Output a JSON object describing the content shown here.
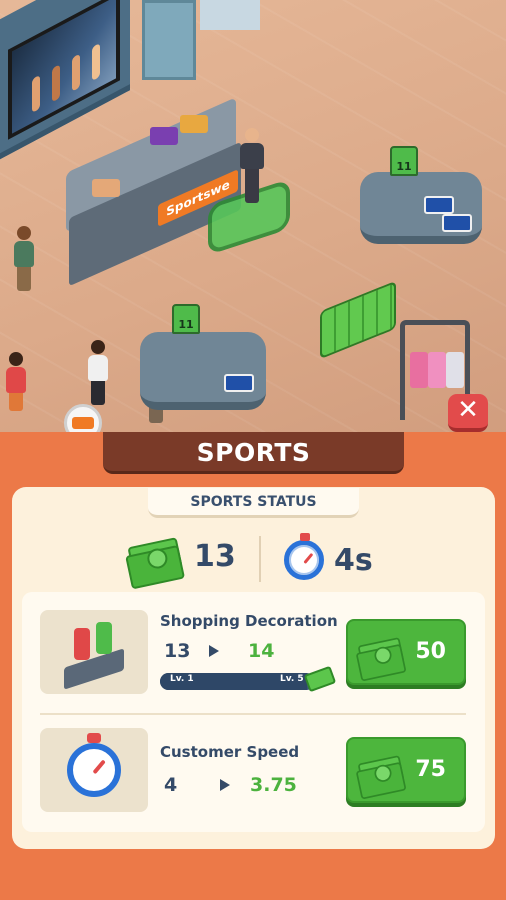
{
  "scene": {
    "counter_sign": "Sportswe",
    "jersey_number": "11",
    "close_label": "✕"
  },
  "panel": {
    "title": "SPORTS",
    "status_label": "SPORTS STATUS",
    "stats": {
      "cash_value": "13",
      "time_value": "4s",
      "cash_icon": "cash-icon",
      "time_icon": "stopwatch-icon"
    }
  },
  "upgrades": [
    {
      "name": "Shopping Decoration",
      "from": "13",
      "to": "14",
      "progress_start_label": "Lv. 1",
      "progress_end_label": "Lv. 5",
      "progress_fraction": 0.95,
      "price": "50",
      "icon": "mannequin-icon"
    },
    {
      "name": "Customer Speed",
      "from": "4",
      "to": "3.75",
      "price": "75",
      "icon": "stopwatch-icon"
    }
  ],
  "colors": {
    "panel_orange": "#ec7948",
    "title_brown": "#7a3a28",
    "text_navy": "#344a68",
    "upgrade_green": "#4cb23e",
    "button_green": "#4db63d",
    "close_red": "#e24b4b"
  }
}
